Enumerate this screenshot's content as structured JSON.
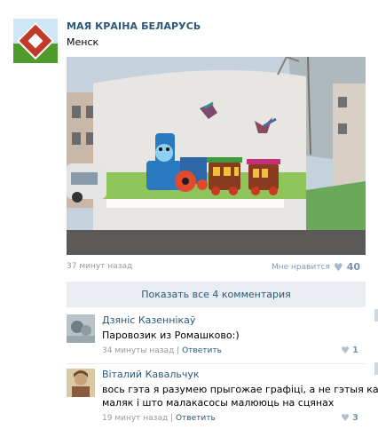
{
  "post": {
    "author": "МАЯ КРАІНА БЕЛАРУСЬ",
    "text": "Менск",
    "time": "37 минут назад",
    "like_label": "Мне нравится",
    "like_icon": "heart-icon",
    "like_count": "40"
  },
  "show_comments_label": "Показать все 4 комментария",
  "comments": [
    {
      "author": "Дзяніс Казеннікаў",
      "text": "Паровозик из Ромашково:)",
      "time": "34 минуты назад",
      "reply_label": "Ответить",
      "like_count": "1"
    },
    {
      "author": "Віталий Кавальчук",
      "text_line1": "вось гэта я разумею прыгожае графіці, а не гэтыя какі-",
      "text_line2": "маляк і што малакасосы малююць на сцянах",
      "time": "19 минут назад",
      "reply_label": "Ответить",
      "like_count": "3"
    }
  ],
  "separator": " | ",
  "colors": {
    "link": "#2b587a",
    "button_bg": "#e9edf1",
    "meta": "#999999"
  }
}
